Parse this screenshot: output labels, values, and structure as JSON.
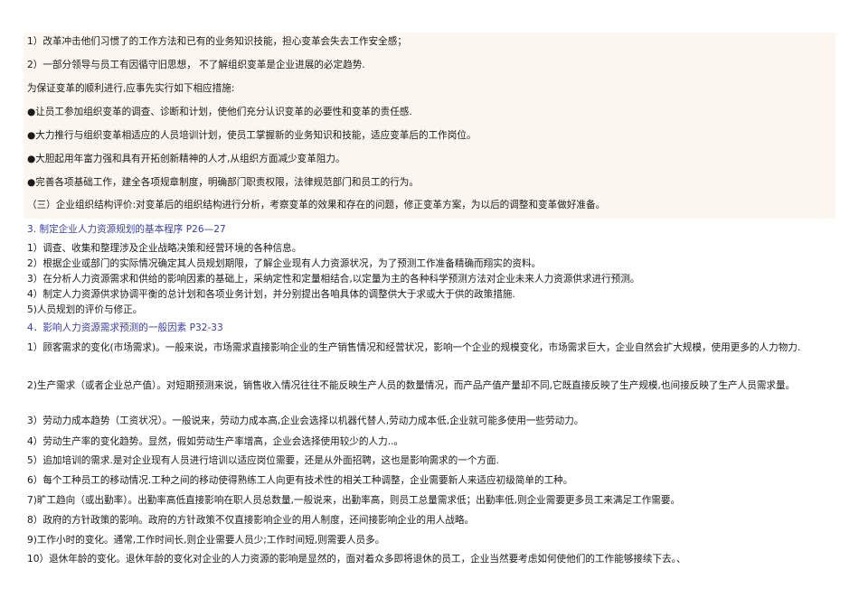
{
  "lines": [
    {
      "text": "1）改革冲击他们习惯了的工作方法和已有的业务知识技能，担心变革会失去工作安全感；"
    },
    {
      "text": "2）一部分领导与员工有因循守旧思想，  不了解组织变革是企业进展的必定趋势."
    },
    {
      "text": "为保证变革的顺利进行,应事先实行如下相应措施:"
    },
    {
      "text": "●让员工参加组织变革的调查、诊断和计划，使他们充分认识变革的必要性和变革的责任感."
    },
    {
      "text": "●大力推行与组织变革相适应的人员培训计划，使员工掌握新的业务知识和技能，适应变革后的工作岗位。"
    },
    {
      "text": "●大胆起用年富力强和具有开拓创新精神的人才,从组织方面减少变革阻力。"
    },
    {
      "text": "●完善各项基础工作，建全各项规章制度，明确部门职责权限，法律规范部门和员工的行为。"
    },
    {
      "text": "（三）企业组织结构评价:对变革后的组织结构进行分析，考察变革的效果和存在的问题，修正变革方案，为以后的调整和变革做好准备。"
    },
    {
      "text": "3. 制定企业人力资源规划的基本程序 P26—27"
    },
    {
      "text": "1）调查、收集和整理涉及企业战略决策和经营环境的各种信息。"
    },
    {
      "text": "2）根据企业或部门的实际情况确定其人员规划期限，了解企业现有人力资源状况，为了预测工作准备精确而翔实的资料。"
    },
    {
      "text": "3）在分析人力资源需求和供给的影响因素的基础上，采纳定性和定量相结合,以定量为主的各种科学预测方法对企业未来人力资源供求进行预测。"
    },
    {
      "text": "4）制定人力资源供求协调平衡的总计划和各项业务计划，并分别提出各咱具体的调整供大于求或大于供的政策措施."
    },
    {
      "text": "5)人员规划的评价与修正。"
    },
    {
      "text": "4．影响人力资源需求预测的一般因素 P32-33"
    },
    {
      "text": "1）顾客需求的变化(市场需求)。一般来说，市场需求直接影响企业的生产销售情况和经营状况，影响一个企业的规模变化，市场需求巨大，企业自然会扩大规模，使用更多的人力物力."
    },
    {
      "text": "2)生产需求（或者企业总产值）。对短期预测来说，销售收入情况往往不能反映生产人员的数量情况，而产品产值产量却不同,它既直接反映了生产规模,也间接反映了生产人员需求量。"
    },
    {
      "text": "3）劳动力成本趋势（工资状况）。一般说来，劳动力成本高,企业会选择以机器代替人,劳动力成本低,企业就可能多使用一些劳动力。"
    },
    {
      "text": "4）劳动生产率的变化趋势。显然，假如劳动生产率增高，企业会选择使用较少的人力..。"
    },
    {
      "text": "5）追加培训的需求.是对企业现有人员进行培训以适应岗位需要，还是从外面招聘，这也是影响需求的一个方面."
    },
    {
      "text": "6）每个工种员工的移动情况.工种之间的移动使得熟练工人向更有技术性的相关工种调整，企业需要新人来适应初级简单的工种。"
    },
    {
      "text": "7)旷工趋向（或出勤率）。出勤率高低直接影响在职人员总数量,一般说来，出勤率高，则员工总量需求低；出勤率低,则企业需要更多员工来满足工作需要。"
    },
    {
      "text": "8）政府的方针政策的影响。政府的方针政策不仅直接影响企业的用人制度，还间接影响企业的用人战略。"
    },
    {
      "text": "9)工作小时的变化。通常,工作时间长,则企业需要人员少;工作时间短,则需要人员多。"
    },
    {
      "text": "10）退休年龄的变化。退休年龄的变化对企业的人力资源的影响是显然的，面对着众多即将退休的员工，企业当然要考虑如何使他们的工作能够接续下去。、"
    }
  ]
}
